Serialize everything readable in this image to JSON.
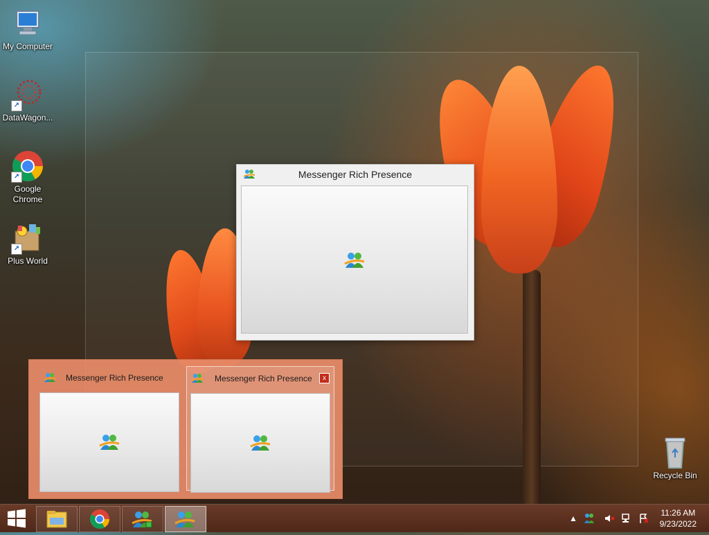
{
  "desktop": {
    "icons": [
      {
        "label": "My Computer"
      },
      {
        "label": "DataWagon..."
      },
      {
        "label": "Google Chrome"
      },
      {
        "label": "Plus World"
      },
      {
        "label": "Recycle Bin"
      }
    ]
  },
  "main_window": {
    "title": "Messenger Rich Presence",
    "icon": "msn-messenger-icon"
  },
  "thumbnail_popup": {
    "thumbs": [
      {
        "title": "Messenger Rich Presence"
      },
      {
        "title": "Messenger Rich Presence",
        "close": "x"
      }
    ]
  },
  "taskbar": {
    "buttons": [
      "start-icon",
      "file-explorer-icon",
      "chrome-icon",
      "msn-messenger-icon",
      "msn-messenger-icon"
    ],
    "tray": {
      "overflow": "▲",
      "icons": [
        "msn-messenger-icon",
        "speaker-muted-icon",
        "network-icon",
        "action-center-icon"
      ]
    },
    "clock": {
      "time": "11:26 AM",
      "date": "9/23/2022"
    }
  },
  "colors": {
    "thumbnail_bg": "#e88c69",
    "close_red": "#c42b1c"
  }
}
